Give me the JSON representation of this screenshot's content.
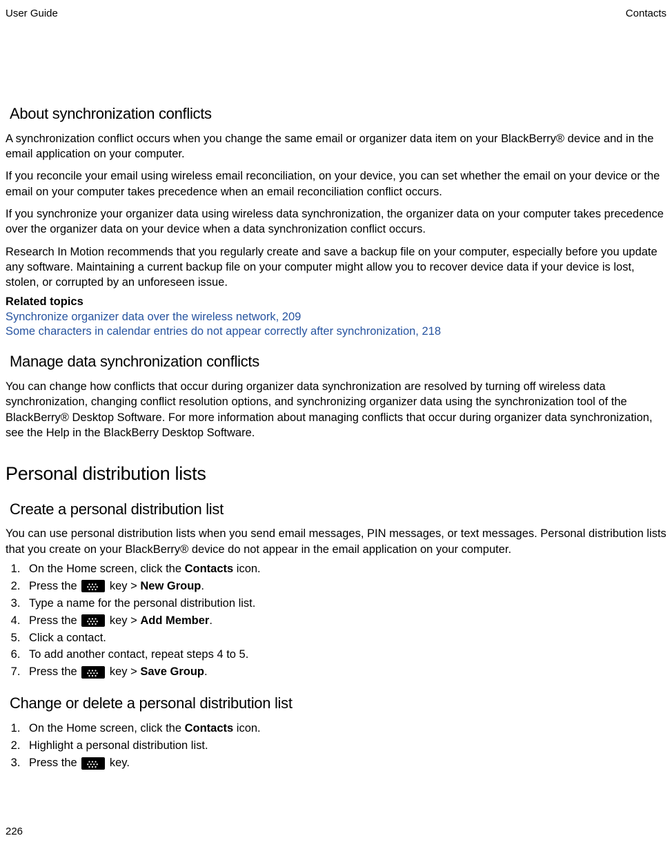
{
  "header": {
    "left": "User Guide",
    "right": "Contacts"
  },
  "section1": {
    "heading": "About synchronization conflicts",
    "p1": "A synchronization conflict occurs when you change the same email or organizer data item on your BlackBerry® device and in the email application on your computer.",
    "p2": "If you reconcile your email using wireless email reconciliation, on your device, you can set whether the email on your device or the email on your computer takes precedence when an email reconciliation conflict occurs.",
    "p3": "If you synchronize your organizer data using wireless data synchronization, the organizer data on your computer takes precedence over the organizer data on your device when a data synchronization conflict occurs.",
    "p4": "Research In Motion recommends that you regularly create and save a backup file on your computer, especially before you update any software. Maintaining a current backup file on your computer might allow you to recover device data if your device is lost, stolen, or corrupted by an unforeseen issue.",
    "related_heading": "Related topics",
    "link1": "Synchronize organizer data over the wireless network, 209",
    "link2": "Some characters in calendar entries do not appear correctly after synchronization, 218"
  },
  "section2": {
    "heading": "Manage data synchronization conflicts",
    "p1": "You can change how conflicts that occur during organizer data synchronization are resolved by turning off wireless data synchronization, changing conflict resolution options, and synchronizing organizer data using the synchronization tool of the BlackBerry® Desktop Software. For more information about managing conflicts that occur during organizer data synchronization, see the Help in the BlackBerry Desktop Software."
  },
  "section3": {
    "heading_main": "Personal distribution lists",
    "sub1": {
      "heading": "Create a personal distribution list",
      "intro": "You can use personal distribution lists when you send email messages, PIN messages, or text messages. Personal distribution lists that you create on your BlackBerry® device do not appear in the email application on your computer.",
      "steps": {
        "s1_a": "On the Home screen, click the ",
        "s1_b": "Contacts",
        "s1_c": " icon.",
        "s2_a": "Press the ",
        "s2_b": " key > ",
        "s2_c": "New Group",
        "s2_d": ".",
        "s3": "Type a name for the personal distribution list.",
        "s4_a": "Press the ",
        "s4_b": " key > ",
        "s4_c": "Add Member",
        "s4_d": ".",
        "s5": "Click a contact.",
        "s6": "To add another contact, repeat steps 4 to 5.",
        "s7_a": "Press the ",
        "s7_b": " key > ",
        "s7_c": "Save Group",
        "s7_d": "."
      }
    },
    "sub2": {
      "heading": "Change or delete a personal distribution list",
      "steps": {
        "s1_a": "On the Home screen, click the ",
        "s1_b": "Contacts",
        "s1_c": " icon.",
        "s2": "Highlight a personal distribution list.",
        "s3_a": "Press the ",
        "s3_b": " key."
      }
    }
  },
  "page_number": "226"
}
